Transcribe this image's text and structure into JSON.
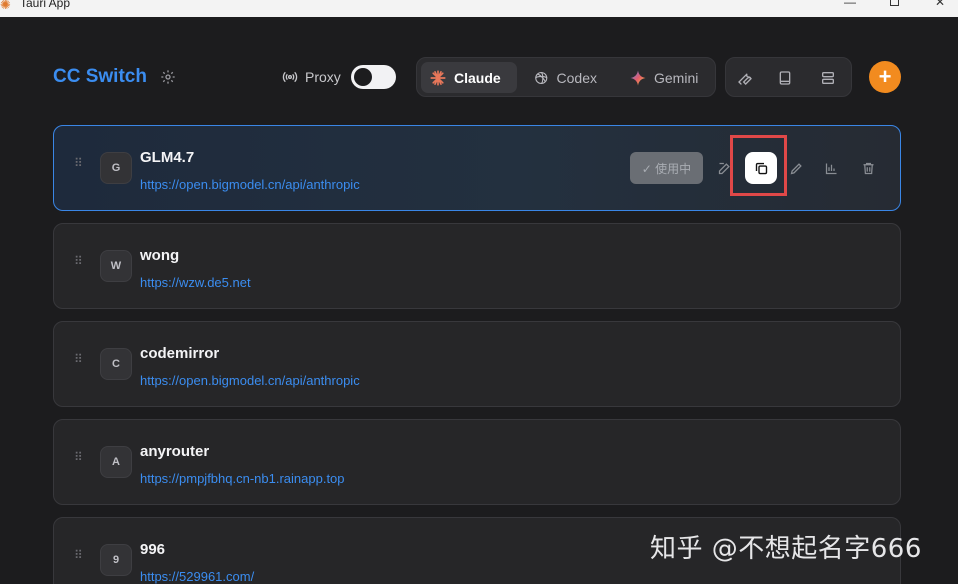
{
  "window": {
    "title": "Tauri App",
    "minimize": "—",
    "close": "✕"
  },
  "header": {
    "brand": "CC Switch",
    "proxy_label": "Proxy",
    "proxy_enabled": false,
    "tabs": [
      {
        "label": "Claude",
        "active": true,
        "icon": "claude-icon"
      },
      {
        "label": "Codex",
        "active": false,
        "icon": "codex-icon"
      },
      {
        "label": "Gemini",
        "active": false,
        "icon": "gemini-icon"
      }
    ],
    "tools": [
      "wrench-icon",
      "book-icon",
      "layers-icon"
    ],
    "add_label": "+"
  },
  "colors": {
    "accent": "#3b8df0",
    "add_button": "#f28b1f",
    "highlight": "#e04848"
  },
  "providers": [
    {
      "initial": "G",
      "name": "GLM4.7",
      "url": "https://open.bigmodel.cn/api/anthropic",
      "active": true,
      "in_use_label": "✓ 使用中"
    },
    {
      "initial": "W",
      "name": "wong",
      "url": "https://wzw.de5.net",
      "active": false
    },
    {
      "initial": "C",
      "name": "codemirror",
      "url": "https://open.bigmodel.cn/api/anthropic",
      "active": false
    },
    {
      "initial": "A",
      "name": "anyrouter",
      "url": "https://pmpjfbhq.cn-nb1.rainapp.top",
      "active": false
    },
    {
      "initial": "9",
      "name": "996",
      "url": "https://529961.com/",
      "active": false
    }
  ],
  "watermark": "知乎 @不想起名字666"
}
